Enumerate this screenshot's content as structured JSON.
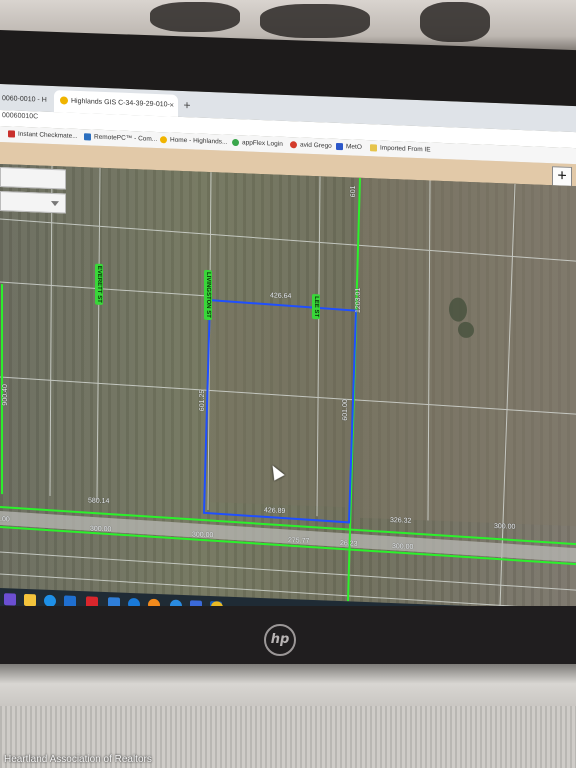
{
  "browser": {
    "tabs": [
      {
        "label": "0060-0010 - H",
        "active": false
      },
      {
        "label": "Highlands GIS C-34-39-29-010-",
        "active": true
      }
    ],
    "new_tab_symbol": "+",
    "tab_close_symbol": "×",
    "url": "00060010C",
    "bookmarks": [
      {
        "label": "Instant Checkmate...",
        "icon": "checkmate-icon",
        "color": "#c9302c"
      },
      {
        "label": "RemotePC™ - Com...",
        "icon": "remotepc-icon",
        "color": "#2c6fbf"
      },
      {
        "label": "Home - Highlands...",
        "icon": "highlands-icon",
        "color": "#f0b400"
      },
      {
        "label": "appFlex Login",
        "icon": "appflex-icon",
        "color": "#3aa64b"
      },
      {
        "label": "avid Grego",
        "icon": "avid-icon",
        "color": "#d43c2c"
      },
      {
        "label": "MetO",
        "icon": "meto-icon",
        "color": "#2b57c9"
      },
      {
        "label": "Imported From IE",
        "icon": "folder-icon",
        "color": "#e6c44b"
      }
    ]
  },
  "gis": {
    "add_button_symbol": "+",
    "street_labels": [
      "EVERETT ST",
      "LIVINGSTON ST",
      "LEE ST"
    ],
    "dimension_labels": {
      "top": "426.64",
      "bottom_left": "580.14",
      "bottom_parcel": "426.89",
      "right_row": "326.32",
      "far_right": "300.00",
      "road_left": "300.00",
      "road_mid": "300.00",
      "road_mid2": "275.77",
      "road_right": "26.23",
      "road_far": "300.00",
      "edge_left": ".00",
      "parcel_left": "601.25",
      "parcel_right": "601.00",
      "side_left": "900.40",
      "right_top": "1203.01",
      "top_corner": "601"
    },
    "colors": {
      "parcel": "#1f4fff",
      "road_line": "#2cf02c",
      "label_bg": "#39d739"
    }
  },
  "taskbar": {
    "icons": [
      {
        "name": "media-icon",
        "color": "#6b4fd3"
      },
      {
        "name": "file-explorer-icon",
        "color": "#f2c33c"
      },
      {
        "name": "edge-icon",
        "color": "#1e90e8"
      },
      {
        "name": "store-icon",
        "color": "#1f6fd0"
      },
      {
        "name": "mcafee-icon",
        "color": "#d9262c"
      },
      {
        "name": "mail-icon",
        "color": "#2f7ed8"
      },
      {
        "name": "help-icon",
        "color": "#1a7ad9"
      },
      {
        "name": "vlc-icon",
        "color": "#f28a1c"
      },
      {
        "name": "globe-icon",
        "color": "#2a8be0"
      },
      {
        "name": "remote-desktop-icon",
        "color": "#3b6ad9"
      },
      {
        "name": "photos-icon",
        "color": "#1d5fb8"
      },
      {
        "name": "chrome-icon",
        "color": "#e9b925"
      }
    ]
  },
  "device": {
    "brand_logo": "hp"
  },
  "watermark": "Heartland Association of Realtors"
}
